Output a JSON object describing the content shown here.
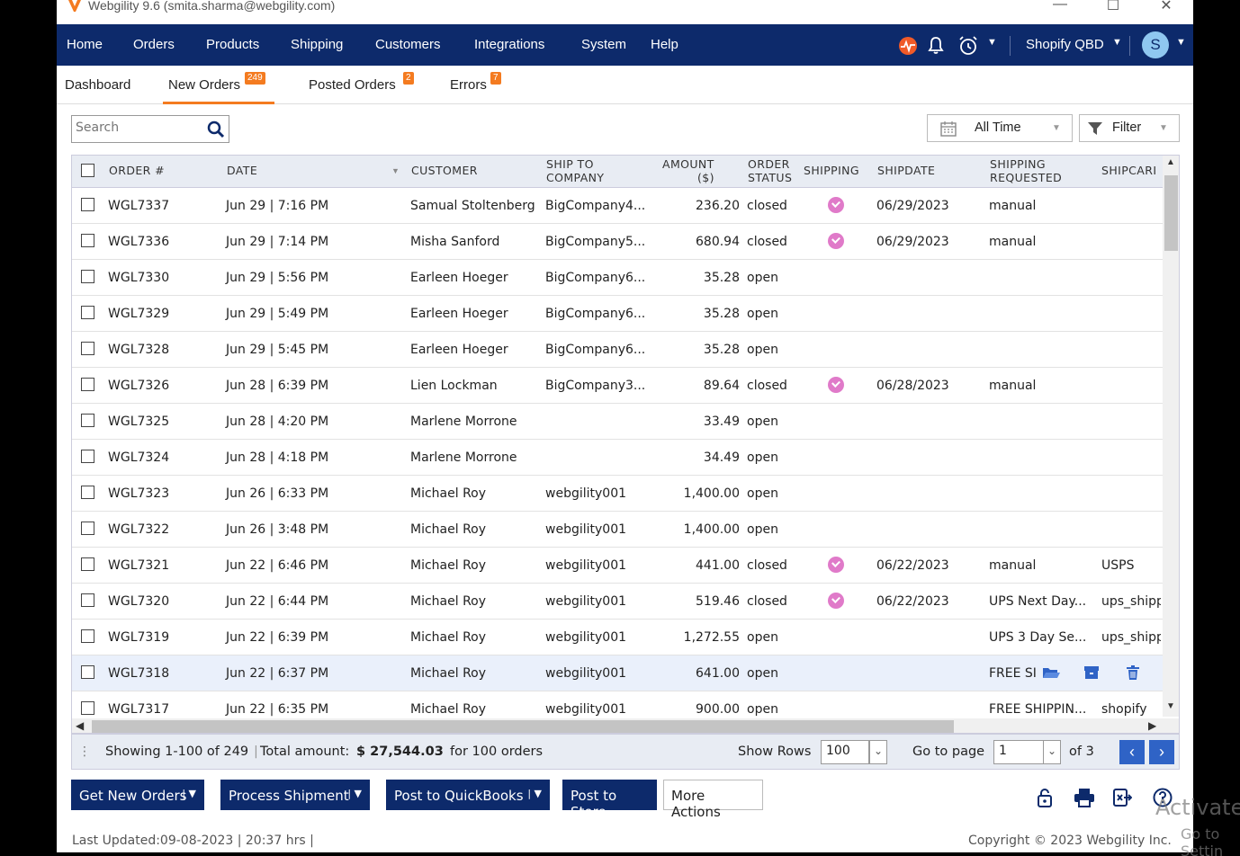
{
  "window": {
    "title": "Webgility 9.6 (smita.sharma@webgility.com)",
    "minimize": "—",
    "maximize": "☐",
    "close": "✕"
  },
  "nav": {
    "items": [
      "Home",
      "Orders",
      "Products",
      "Shipping",
      "Customers",
      "Integrations",
      "System",
      "Help"
    ],
    "store": "Shopify QBD",
    "avatar": "S"
  },
  "tabs": [
    {
      "label": "Dashboard",
      "badge": ""
    },
    {
      "label": "New Orders",
      "badge": "249"
    },
    {
      "label": "Posted Orders",
      "badge": "2"
    },
    {
      "label": "Errors",
      "badge": "7"
    }
  ],
  "search": {
    "placeholder": "Search"
  },
  "time_filter": "All Time",
  "filter_label": "Filter",
  "columns": {
    "order": "ORDER #",
    "date": "DATE",
    "customer": "CUSTOMER",
    "ship_to_1": "SHIP TO",
    "ship_to_2": "COMPANY",
    "amount_1": "AMOUNT",
    "amount_2": "($)",
    "status_1": "ORDER",
    "status_2": "STATUS",
    "shipping": "SHIPPING",
    "shipdate": "SHIPDATE",
    "req_1": "SHIPPING",
    "req_2": "REQUESTED",
    "carrier": "SHIPCARI"
  },
  "rows": [
    {
      "order": "WGL7337",
      "date": "Jun 29 | 7:16 PM",
      "customer": "Samual Stoltenberg",
      "company": "BigCompany4...",
      "amount": "236.20",
      "status": "closed",
      "shipped": true,
      "shipdate": "06/29/2023",
      "requested": "manual",
      "carrier": ""
    },
    {
      "order": "WGL7336",
      "date": "Jun 29 | 7:14 PM",
      "customer": "Misha Sanford",
      "company": "BigCompany5...",
      "amount": "680.94",
      "status": "closed",
      "shipped": true,
      "shipdate": "06/29/2023",
      "requested": "manual",
      "carrier": ""
    },
    {
      "order": "WGL7330",
      "date": "Jun 29 | 5:56 PM",
      "customer": "Earleen Hoeger",
      "company": "BigCompany6...",
      "amount": "35.28",
      "status": "open",
      "shipped": false,
      "shipdate": "",
      "requested": "",
      "carrier": ""
    },
    {
      "order": "WGL7329",
      "date": "Jun 29 | 5:49 PM",
      "customer": "Earleen Hoeger",
      "company": "BigCompany6...",
      "amount": "35.28",
      "status": "open",
      "shipped": false,
      "shipdate": "",
      "requested": "",
      "carrier": ""
    },
    {
      "order": "WGL7328",
      "date": "Jun 29 | 5:45 PM",
      "customer": "Earleen Hoeger",
      "company": "BigCompany6...",
      "amount": "35.28",
      "status": "open",
      "shipped": false,
      "shipdate": "",
      "requested": "",
      "carrier": ""
    },
    {
      "order": "WGL7326",
      "date": "Jun 28 | 6:39 PM",
      "customer": "Lien Lockman",
      "company": "BigCompany3...",
      "amount": "89.64",
      "status": "closed",
      "shipped": true,
      "shipdate": "06/28/2023",
      "requested": "manual",
      "carrier": ""
    },
    {
      "order": "WGL7325",
      "date": "Jun 28 | 4:20 PM",
      "customer": "Marlene Morrone",
      "company": "",
      "amount": "33.49",
      "status": "open",
      "shipped": false,
      "shipdate": "",
      "requested": "",
      "carrier": ""
    },
    {
      "order": "WGL7324",
      "date": "Jun 28 | 4:18 PM",
      "customer": "Marlene Morrone",
      "company": "",
      "amount": "34.49",
      "status": "open",
      "shipped": false,
      "shipdate": "",
      "requested": "",
      "carrier": ""
    },
    {
      "order": "WGL7323",
      "date": "Jun 26 | 6:33 PM",
      "customer": "Michael Roy",
      "company": "webgility001",
      "amount": "1,400.00",
      "status": "open",
      "shipped": false,
      "shipdate": "",
      "requested": "",
      "carrier": ""
    },
    {
      "order": "WGL7322",
      "date": "Jun 26 | 3:48 PM",
      "customer": "Michael Roy",
      "company": "webgility001",
      "amount": "1,400.00",
      "status": "open",
      "shipped": false,
      "shipdate": "",
      "requested": "",
      "carrier": ""
    },
    {
      "order": "WGL7321",
      "date": "Jun 22 | 6:46 PM",
      "customer": "Michael Roy",
      "company": "webgility001",
      "amount": "441.00",
      "status": "closed",
      "shipped": true,
      "shipdate": "06/22/2023",
      "requested": "manual",
      "carrier": "USPS"
    },
    {
      "order": "WGL7320",
      "date": "Jun 22 | 6:44 PM",
      "customer": "Michael Roy",
      "company": "webgility001",
      "amount": "519.46",
      "status": "closed",
      "shipped": true,
      "shipdate": "06/22/2023",
      "requested": "UPS Next Day...",
      "carrier": "ups_shipp"
    },
    {
      "order": "WGL7319",
      "date": "Jun 22 | 6:39 PM",
      "customer": "Michael Roy",
      "company": "webgility001",
      "amount": "1,272.55",
      "status": "open",
      "shipped": false,
      "shipdate": "",
      "requested": "UPS 3 Day Se...",
      "carrier": "ups_shipp"
    },
    {
      "order": "WGL7318",
      "date": "Jun 22 | 6:37 PM",
      "customer": "Michael Roy",
      "company": "webgility001",
      "amount": "641.00",
      "status": "open",
      "shipped": false,
      "shipdate": "",
      "requested": "FREE SI",
      "carrier": "",
      "hover": true
    },
    {
      "order": "WGL7317",
      "date": "Jun 22 | 6:35 PM",
      "customer": "Michael Roy",
      "company": "webgility001",
      "amount": "900.00",
      "status": "open",
      "shipped": false,
      "shipdate": "",
      "requested": "FREE SHIPPIN...",
      "carrier": "shopify"
    }
  ],
  "footer": {
    "showing": "Showing 1-100 of 249",
    "total_label": "Total amount:",
    "total_value": "$ 27,544.03",
    "total_suffix": "for 100 orders",
    "show_rows_label": "Show Rows",
    "show_rows_value": "100",
    "goto_label": "Go to page",
    "goto_value": "1",
    "of_pages": "of 3"
  },
  "actions": {
    "get_new_orders": "Get New Orders",
    "process_shipment": "Process Shipment",
    "post_quickbooks": "Post to QuickBooks",
    "post_store": "Post to Store",
    "more_actions": "More Actions"
  },
  "last_updated": "Last Updated:09-08-2023 | 20:37 hrs |",
  "copyright": "Copyright © 2023 Webgility Inc.",
  "watermark": "Activate",
  "watermark2": "Go to Settin",
  "colors": {
    "nav": "#0d2a6b",
    "accent": "#f47b20",
    "check": "#e07ac9",
    "pager": "#2f63c6"
  }
}
